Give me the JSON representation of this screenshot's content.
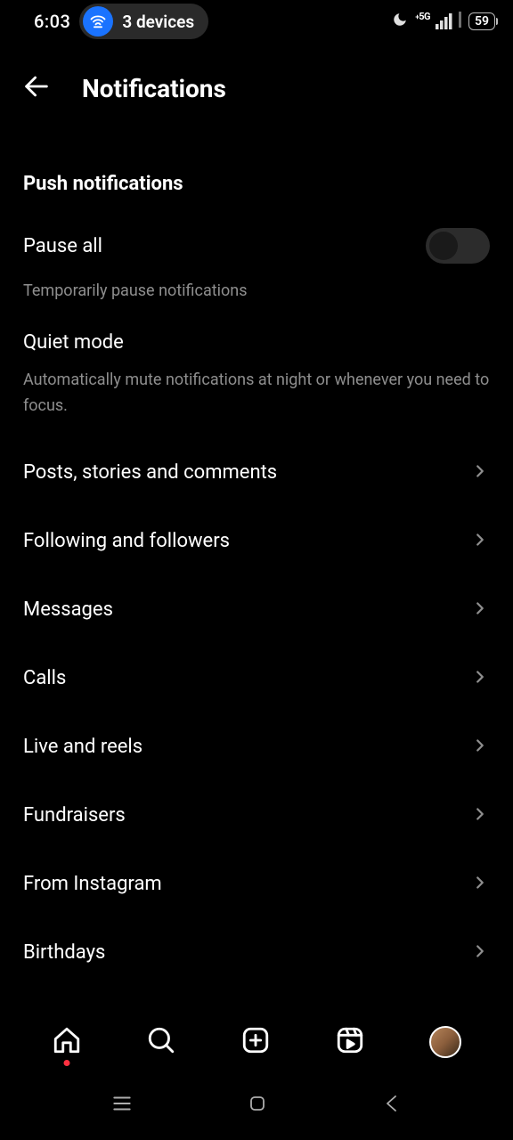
{
  "status_bar": {
    "time": "6:03",
    "devices_label": "3 devices",
    "network_label": "5G",
    "battery": "59"
  },
  "header": {
    "title": "Notifications"
  },
  "section_header": "Push notifications",
  "pause_all": {
    "label": "Pause all",
    "subtext": "Temporarily pause notifications",
    "enabled": false
  },
  "quiet_mode": {
    "label": "Quiet mode",
    "subtext": "Automatically mute notifications at night or whenever you need to focus."
  },
  "items": [
    {
      "label": "Posts, stories and comments"
    },
    {
      "label": "Following and followers"
    },
    {
      "label": "Messages"
    },
    {
      "label": "Calls"
    },
    {
      "label": "Live and reels"
    },
    {
      "label": "Fundraisers"
    },
    {
      "label": "From Instagram"
    },
    {
      "label": "Birthdays"
    }
  ]
}
